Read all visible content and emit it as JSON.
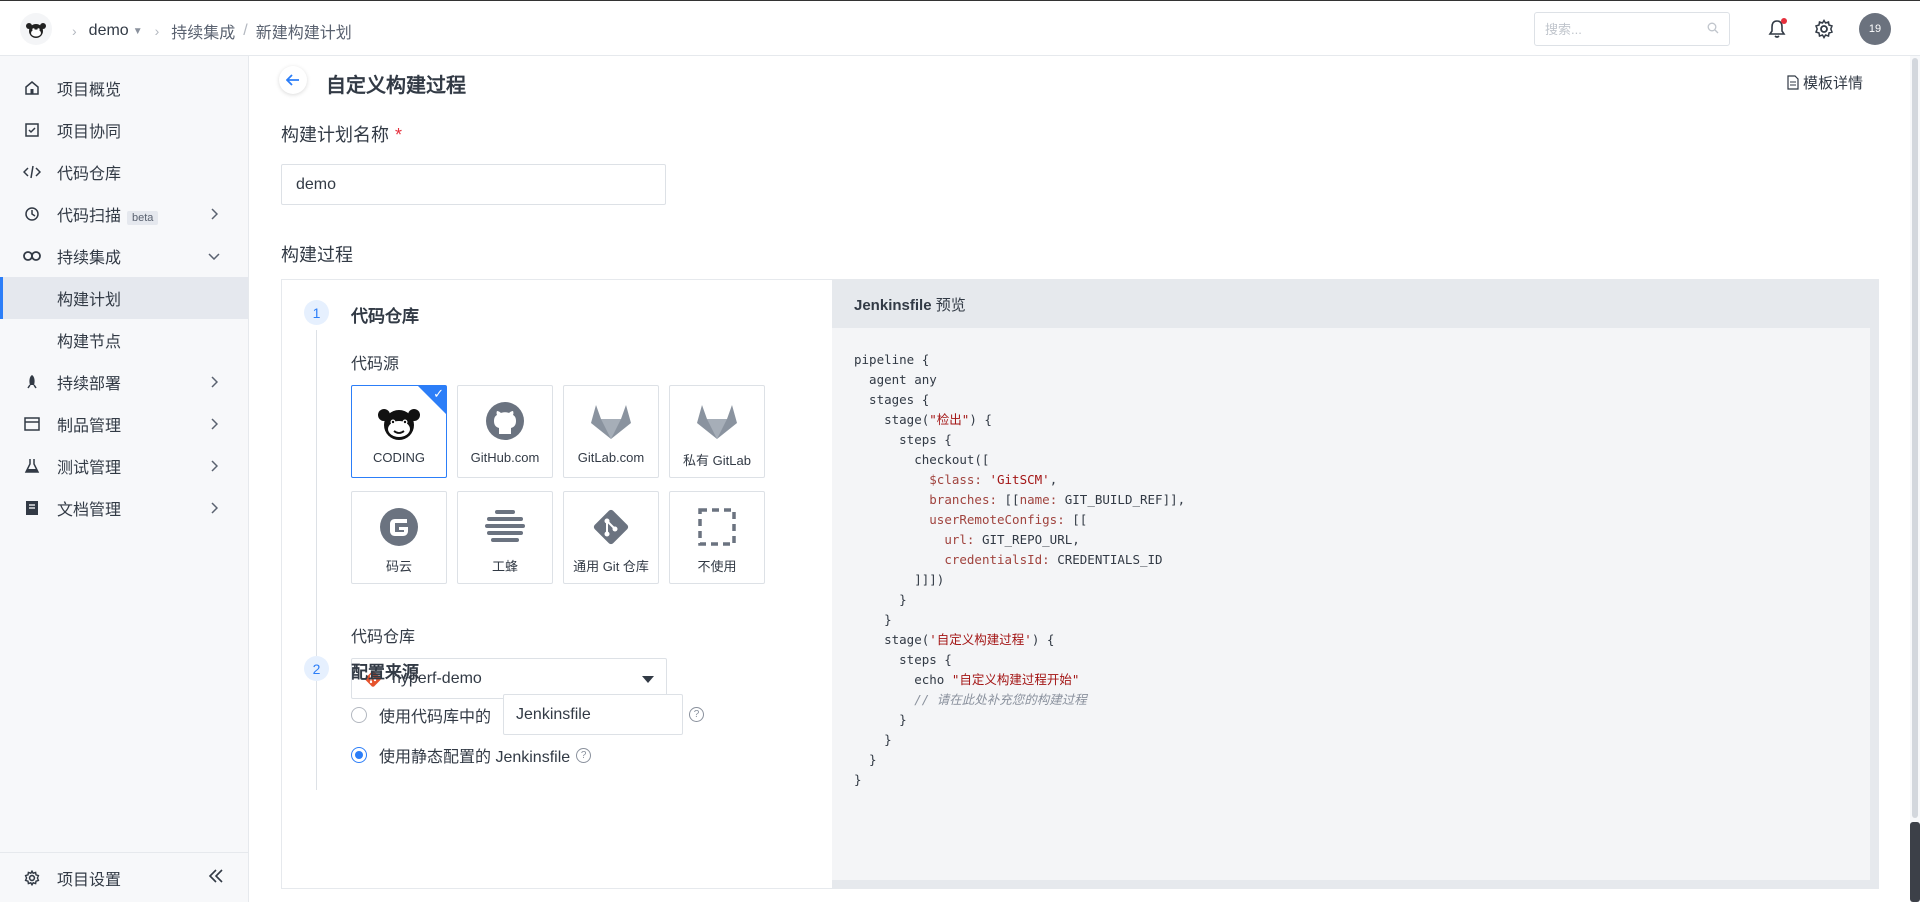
{
  "header": {
    "project": "demo",
    "crumb_parent": "持续集成",
    "crumb_current": "新建构建计划",
    "search_placeholder": "搜索...",
    "avatar_text": "19"
  },
  "sidebar": {
    "items": [
      {
        "label": "项目概览",
        "icon": "home-icon"
      },
      {
        "label": "项目协同",
        "icon": "check-square-icon"
      },
      {
        "label": "代码仓库",
        "icon": "code-icon"
      },
      {
        "label": "代码扫描",
        "icon": "scan-icon",
        "badge": "beta"
      },
      {
        "label": "持续集成",
        "icon": "infinity-icon"
      },
      {
        "label": "构建计划",
        "active": true
      },
      {
        "label": "构建节点"
      },
      {
        "label": "持续部署",
        "icon": "rocket-icon"
      },
      {
        "label": "制品管理",
        "icon": "box-icon"
      },
      {
        "label": "测试管理",
        "icon": "flask-icon"
      },
      {
        "label": "文档管理",
        "icon": "doc-icon"
      }
    ],
    "settings_label": "项目设置"
  },
  "page": {
    "title": "自定义构建过程",
    "template_link": "模板详情",
    "name_label": "构建计划名称",
    "required_mark": "*",
    "name_value": "demo",
    "process_label": "构建过程"
  },
  "step1": {
    "num": "1",
    "title": "代码仓库",
    "source_label": "代码源",
    "sources": [
      "CODING",
      "GitHub.com",
      "GitLab.com",
      "私有 GitLab",
      "码云",
      "工蜂",
      "通用 Git 仓库",
      "不使用"
    ],
    "selected_source": "CODING",
    "repo_label": "代码仓库",
    "repo_value": "hyperf-demo"
  },
  "step2": {
    "num": "2",
    "title": "配置来源",
    "option1_label": "使用代码库中的",
    "option1_value": "Jenkinsfile",
    "option2_label": "使用静态配置的 Jenkinsfile",
    "selected": "option2"
  },
  "preview": {
    "title": "Jenkinsfile",
    "title_suffix": "预览"
  },
  "colors": {
    "accent": "#2c7ef8",
    "required": "#e52f3c",
    "sidebar_bg": "#f7f8fa",
    "preview_bg": "#f4f5f7"
  }
}
